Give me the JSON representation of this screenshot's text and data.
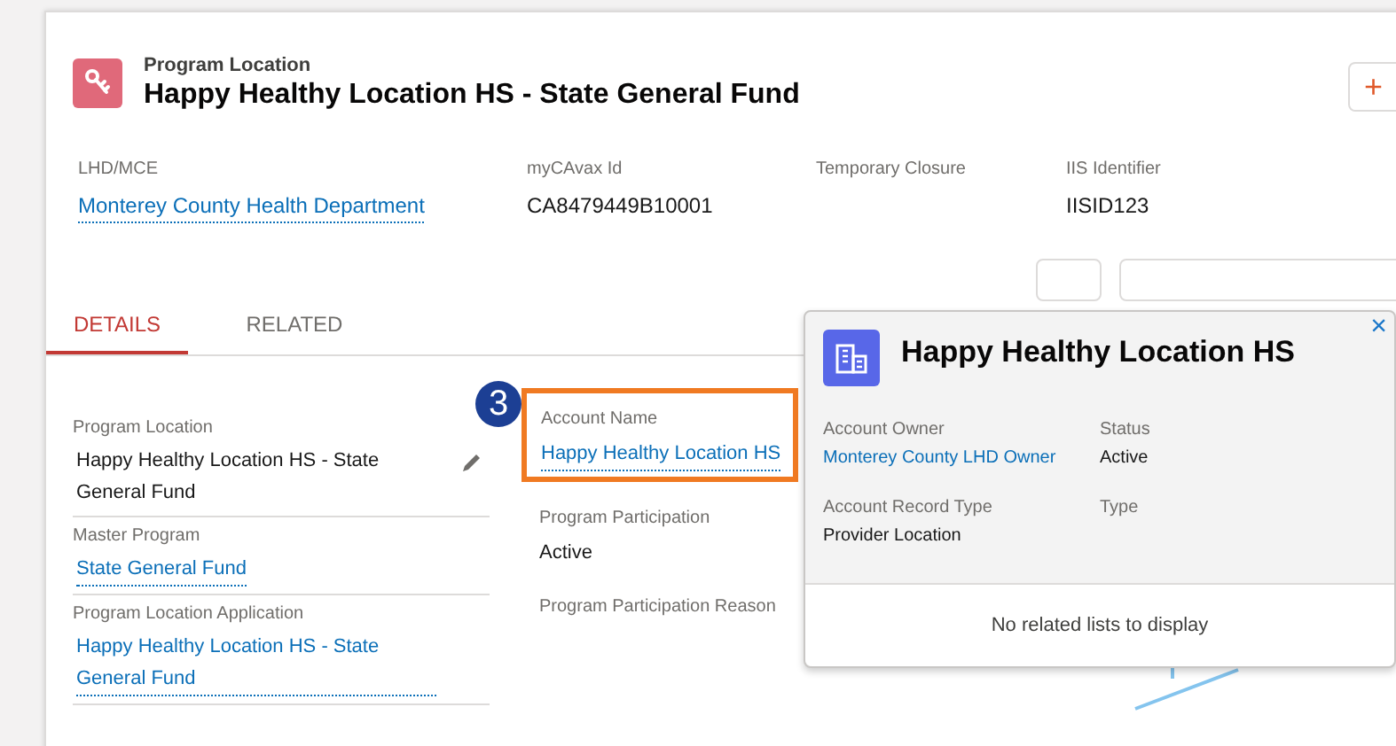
{
  "header": {
    "object_type": "Program Location",
    "title": "Happy Healthy Location HS - State General Fund",
    "action_button": "+"
  },
  "highlights": [
    {
      "label": "LHD/MCE",
      "value": "Monterey County Health Department",
      "link": true
    },
    {
      "label": "myCAvax Id",
      "value": "CA8479449B10001",
      "link": false
    },
    {
      "label": "Temporary Closure"
    },
    {
      "label": "IIS Identifier",
      "value": "IISID123",
      "link": false
    }
  ],
  "tabs": [
    {
      "label": "DETAILS",
      "selected": true
    },
    {
      "label": "RELATED",
      "selected": false
    }
  ],
  "callout": {
    "number": "3"
  },
  "fields_left": [
    {
      "label": "Program Location",
      "value": "Happy Healthy Location HS - State General Fund",
      "link": false,
      "editable": true
    },
    {
      "label": "Master Program",
      "value": "State General Fund",
      "link": true,
      "editable": false
    },
    {
      "label": "Program Location Application",
      "value": "Happy Healthy Location HS - State General Fund",
      "link": true,
      "editable": false
    }
  ],
  "fields_right": [
    {
      "label": "Account Name",
      "value": "Happy Healthy Location HS",
      "link": true,
      "highlighted": true
    },
    {
      "label": "Program Participation",
      "value": "Active",
      "link": false,
      "highlighted": false
    },
    {
      "label": "Program Participation Reason",
      "highlighted": false
    }
  ],
  "popover": {
    "title": "Happy Healthy Location HS",
    "fields": [
      {
        "label": "Account Owner",
        "value": "Monterey County LHD Owner",
        "link": true
      },
      {
        "label": "Status",
        "value": "Active",
        "link": false
      },
      {
        "label": "Account Record Type",
        "value": "Provider Location",
        "link": false
      },
      {
        "label": "Type"
      }
    ],
    "empty_message": "No related lists to display",
    "close": "×"
  }
}
